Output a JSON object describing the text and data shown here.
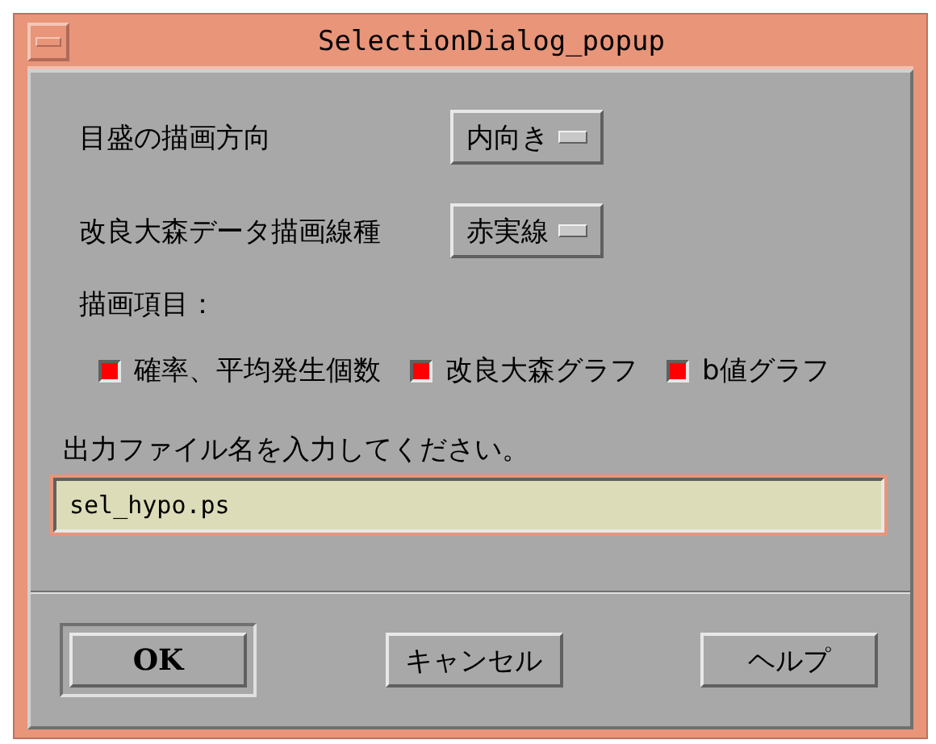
{
  "window": {
    "title": "SelectionDialog_popup"
  },
  "options": [
    {
      "label": "目盛の描画方向",
      "value": "内向き"
    },
    {
      "label": "改良大森データ描画線種",
      "value": "赤実線"
    }
  ],
  "items_label": "描画項目：",
  "checkboxes": [
    {
      "label": "確率、平均発生個数",
      "checked": true
    },
    {
      "label": "改良大森グラフ",
      "checked": true
    },
    {
      "label": "b値グラフ",
      "checked": true
    }
  ],
  "file": {
    "prompt": "出力ファイル名を入力してください。",
    "value": "sel_hypo.ps",
    "focused": true
  },
  "buttons": [
    {
      "label": "OK",
      "default": true
    },
    {
      "label": "キャンセル",
      "default": false
    },
    {
      "label": "ヘルプ",
      "default": false
    }
  ]
}
